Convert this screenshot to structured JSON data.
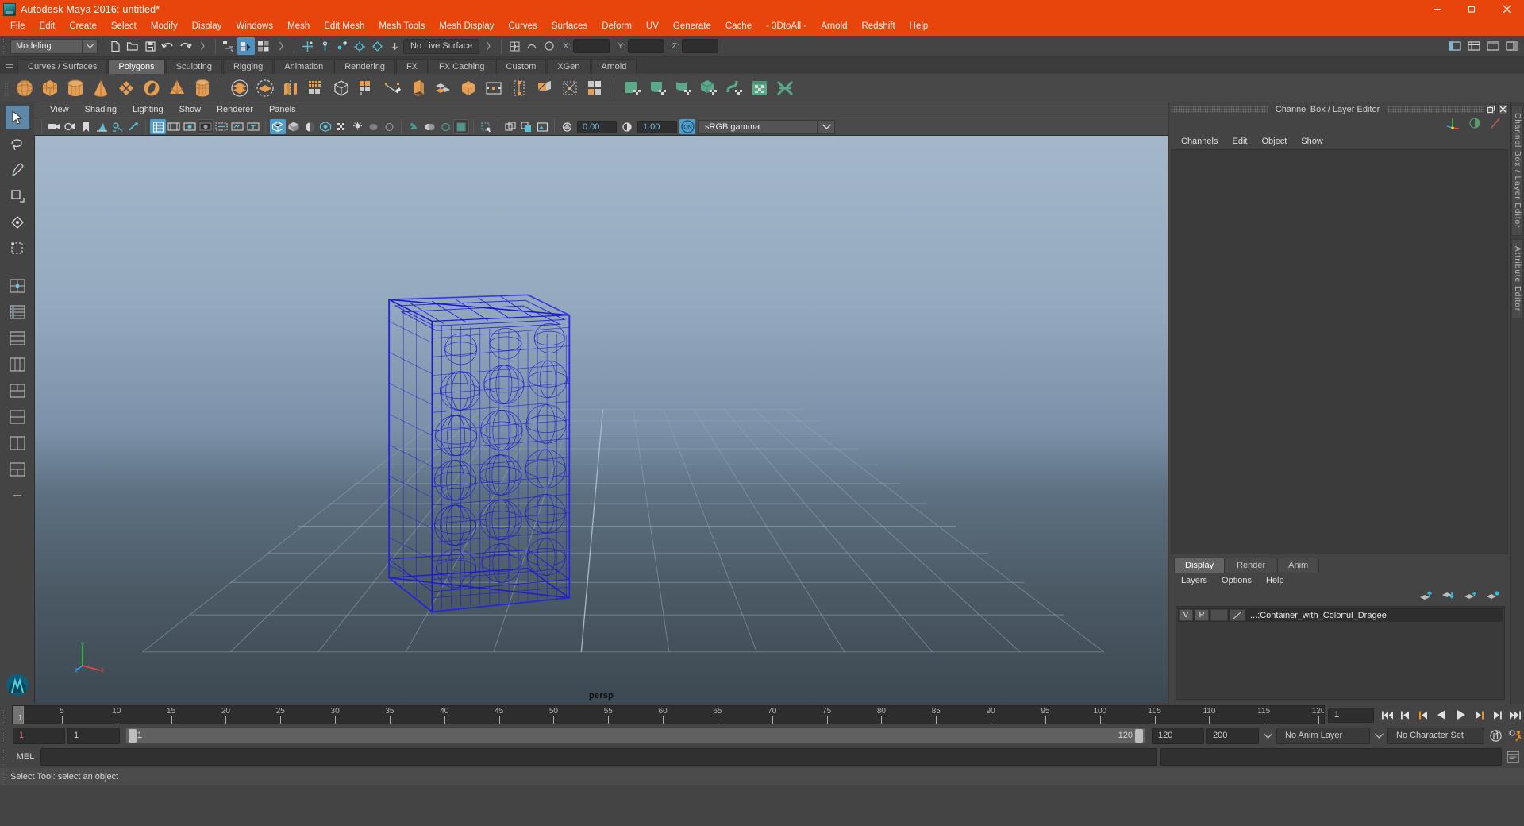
{
  "window": {
    "title": "Autodesk Maya 2016: untitled*",
    "logo_icon": "maya-logo-icon",
    "minimize_label": "Minimize",
    "maximize_label": "Restore",
    "close_label": "Close"
  },
  "menubar": {
    "items": [
      "File",
      "Edit",
      "Create",
      "Select",
      "Modify",
      "Display",
      "Windows",
      "Mesh",
      "Edit Mesh",
      "Mesh Tools",
      "Mesh Display",
      "Curves",
      "Surfaces",
      "Deform",
      "UV",
      "Generate",
      "Cache",
      "- 3DtoAll -",
      "Arnold",
      "Redshift",
      "Help"
    ]
  },
  "statusline": {
    "menuset": "Modeling",
    "live_surface": "No Live Surface",
    "x_label": "X:",
    "y_label": "Y:",
    "z_label": "Z:",
    "x_value": "",
    "y_value": "",
    "z_value": "",
    "icons_left": [
      "new-scene-icon",
      "open-scene-icon",
      "save-scene-icon",
      "undo-icon",
      "redo-icon"
    ],
    "selection_mask_icons": [
      "select-by-hierarchy-icon",
      "select-by-object-type-icon",
      "select-by-component-type-icon"
    ],
    "snap_icons": [
      "snap-to-grid-icon",
      "snap-to-curve-icon",
      "snap-to-point-icon",
      "snap-to-projected-center-icon",
      "snap-to-view-plane-icon",
      "make-live-icon"
    ],
    "right_icons": [
      "show-hide-editors-icon",
      "attribute-editor-icon",
      "tool-settings-icon",
      "channel-box-icon"
    ]
  },
  "shelf": {
    "tabs": [
      "Curves / Surfaces",
      "Polygons",
      "Sculpting",
      "Rigging",
      "Animation",
      "Rendering",
      "FX",
      "FX Caching",
      "Custom",
      "XGen",
      "Arnold"
    ],
    "active_tab": "Polygons",
    "icons_group1": [
      "poly-sphere-icon",
      "poly-cube-icon",
      "poly-cylinder-icon",
      "poly-cone-icon",
      "poly-plane-icon",
      "poly-torus-icon",
      "poly-pyramid-icon",
      "poly-prism-icon"
    ],
    "icons_group2": [
      "poly-combine-icon",
      "poly-separate-icon",
      "poly-mirror-icon",
      "poly-smooth-icon",
      "poly-booleans-icon",
      "poly-extract-icon",
      "poly-create-tool-icon",
      "poly-bevel-icon",
      "poly-bridge-icon",
      "poly-append-icon",
      "poly-cube-shade-icon",
      "poly-wedge-icon",
      "poly-insert-edge-loop-icon",
      "poly-offset-edge-loop-icon",
      "poly-split-icon",
      "poly-multicut-icon"
    ],
    "icons_group3": [
      "uv-planar-icon",
      "uv-cylindrical-icon",
      "uv-spherical-icon",
      "uv-automatic-icon",
      "uv-unfold-icon",
      "uv-editor-icon",
      "uv-cut-sew-icon"
    ]
  },
  "panel": {
    "menus": [
      "View",
      "Shading",
      "Lighting",
      "Show",
      "Renderer",
      "Panels"
    ],
    "toolbar_icons": [
      "select-camera-icon",
      "camera-attributes-icon",
      "bookmark-icon",
      "image-plane-icon",
      "two-sided-lighting-icon",
      "ambient-light-icon",
      "grid-toggle-icon",
      "film-gate-icon",
      "resolution-gate-icon",
      "gate-mask-icon",
      "field-chart-icon",
      "safe-action-icon",
      "title-safe-icon",
      "wireframe-icon",
      "smooth-shade-icon",
      "shaded-flat-icon",
      "hw-texture-icon",
      "use-default-material-icon",
      "shadows-icon",
      "xray-icon",
      "xray-joints-icon",
      "xray-active-components-icon",
      "isolate-select-icon",
      "object-mask-icon",
      "image-based-lighting-icon",
      "exposure-icon",
      "gamma-icon"
    ],
    "exposure_value": "0.00",
    "gamma_value": "1.00",
    "viewtransform_toggle": "ON",
    "color_management": "sRGB gamma",
    "camera_name": "persp",
    "axis_labels": {
      "x": "x",
      "y": "y",
      "z": "z"
    }
  },
  "channelbox": {
    "panel_title": "Channel Box / Layer Editor",
    "undock_label": "Undock",
    "close_label": "Close",
    "menus": [
      "Channels",
      "Edit",
      "Object",
      "Show"
    ],
    "top_icons": [
      "show-manipulators-icon",
      "toggle-channel-icon",
      "speed-channel-icon"
    ],
    "vertical_tabs": [
      "Channel Box / Layer Editor",
      "Attribute Editor"
    ]
  },
  "layereditor": {
    "tabs": [
      "Display",
      "Render",
      "Anim"
    ],
    "active_tab": "Display",
    "menus": [
      "Layers",
      "Options",
      "Help"
    ],
    "buttons": [
      "move-layer-up-icon",
      "move-layer-down-icon",
      "new-layer-icon",
      "new-layer-from-selected-icon"
    ],
    "layers": [
      {
        "visibility": "V",
        "playback": "P",
        "shading": "",
        "name": "...:Container_with_Colorful_Dragee"
      }
    ]
  },
  "timeslider": {
    "current_frame": "1",
    "current_frame_field": "1",
    "tick_values": [
      5,
      10,
      15,
      20,
      25,
      30,
      35,
      40,
      45,
      50,
      55,
      60,
      65,
      70,
      75,
      80,
      85,
      90,
      95,
      100,
      105,
      110,
      115,
      120
    ],
    "range_min": 1,
    "range_max": 120,
    "playback_buttons": [
      "go-to-start-icon",
      "step-back-keyframe-icon",
      "step-back-frame-icon",
      "play-backwards-icon",
      "play-forwards-icon",
      "step-forward-frame-icon",
      "step-forward-keyframe-icon",
      "go-to-end-icon"
    ]
  },
  "rangeslider": {
    "anim_start": "1",
    "range_start": "1",
    "bar_start_label": "1",
    "bar_end_label": "120",
    "range_end": "120",
    "anim_end": "200",
    "anim_layer": "No Anim Layer",
    "character_set": "No Character Set",
    "auto_keyframe_icon": "auto-keyframe-icon",
    "animation_prefs_icon": "animation-preferences-icon"
  },
  "commandline": {
    "language": "MEL",
    "input_value": "",
    "output_value": "",
    "script_editor_icon": "script-editor-icon"
  },
  "helpline": {
    "text": "Select Tool: select an object"
  },
  "toolbox": {
    "tools": [
      {
        "name": "select-tool",
        "active": true
      },
      {
        "name": "lasso-select-tool",
        "active": false
      },
      {
        "name": "paint-select-tool",
        "active": false
      },
      {
        "name": "move-tool",
        "active": false
      },
      {
        "name": "rotate-tool",
        "active": false
      },
      {
        "name": "scale-tool",
        "active": false
      },
      {
        "name": "last-tool-used",
        "active": false
      }
    ],
    "layout_presets": [
      "single-perspective-view",
      "four-view",
      "outliner-persp-view",
      "hypershade-persp-view",
      "persp-graph-editor",
      "two-pane-stacked",
      "two-pane-side",
      "three-pane-split"
    ]
  },
  "colors": {
    "titlebar": "#e8450d",
    "chrome": "#444444",
    "shelf_active": "#636363",
    "accent_blue": "#4f9dcc",
    "shelf_icon_orange": "#e59d52",
    "shelf_icon_green": "#5aaa8a",
    "wireframe_blue": "#1818d8",
    "viewport_sky": "#9fb3c8",
    "viewport_floor": "#3f4c57"
  }
}
